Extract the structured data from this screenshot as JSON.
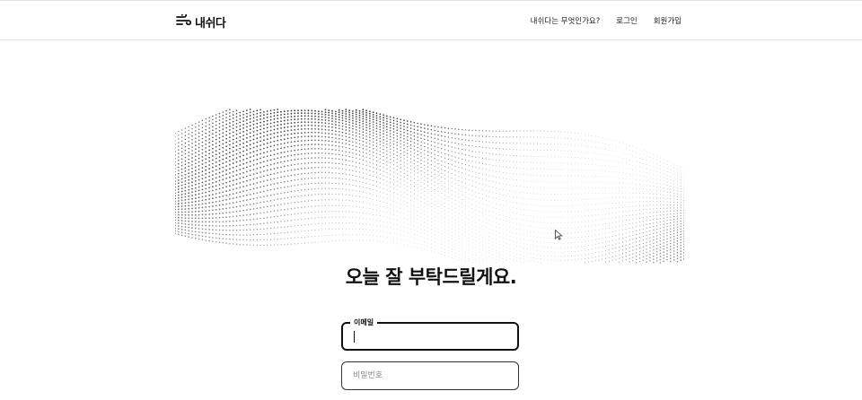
{
  "header": {
    "logo_text": "내쉬다",
    "logo_icon": "wind-icon",
    "nav": [
      {
        "label": "내쉬다는 무엇인가요?"
      },
      {
        "label": "로그인"
      },
      {
        "label": "회원가입"
      }
    ]
  },
  "hero": {
    "image": "particle-wave-illustration"
  },
  "main": {
    "headline": "오늘 잘 부탁드릴게요.",
    "email_label": "이메일",
    "email_value": "",
    "password_placeholder": "비밀번호",
    "password_value": ""
  },
  "colors": {
    "text": "#111111",
    "border": "#333333",
    "divider": "#e2e2e2"
  }
}
